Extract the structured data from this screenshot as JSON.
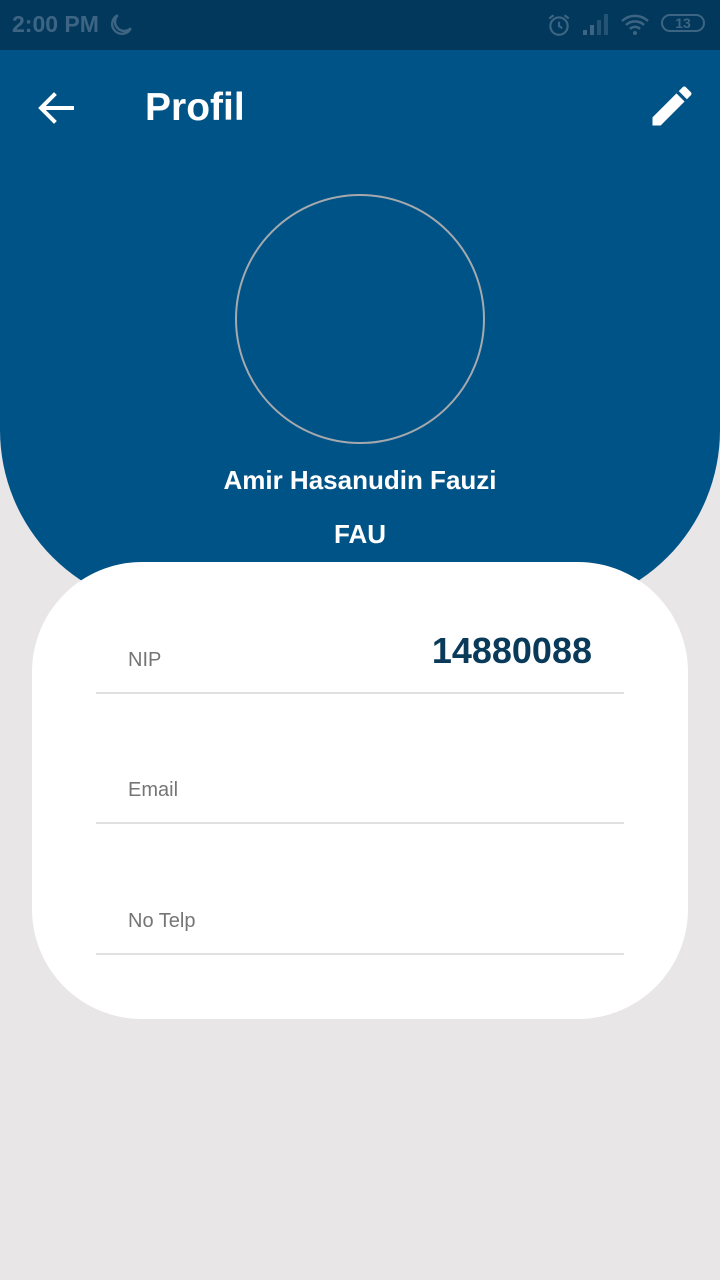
{
  "status_bar": {
    "time": "2:00 PM",
    "battery": "13",
    "icons": [
      "moon-icon",
      "alarm-icon",
      "signal-icon",
      "wifi-icon",
      "battery-icon"
    ]
  },
  "toolbar": {
    "title": "Profil",
    "back_icon": "arrow-left-icon",
    "edit_icon": "pencil-icon"
  },
  "profile": {
    "name": "Amir Hasanudin Fauzi",
    "code": "FAU"
  },
  "fields": [
    {
      "label": "NIP",
      "value": "14880088"
    },
    {
      "label": "Email",
      "value": ""
    },
    {
      "label": "No Telp",
      "value": ""
    }
  ],
  "colors": {
    "primary": "#005387",
    "status_bar": "#02385b",
    "background": "#e8e6e7",
    "card": "#ffffff",
    "value_text": "#0a3a5a"
  }
}
